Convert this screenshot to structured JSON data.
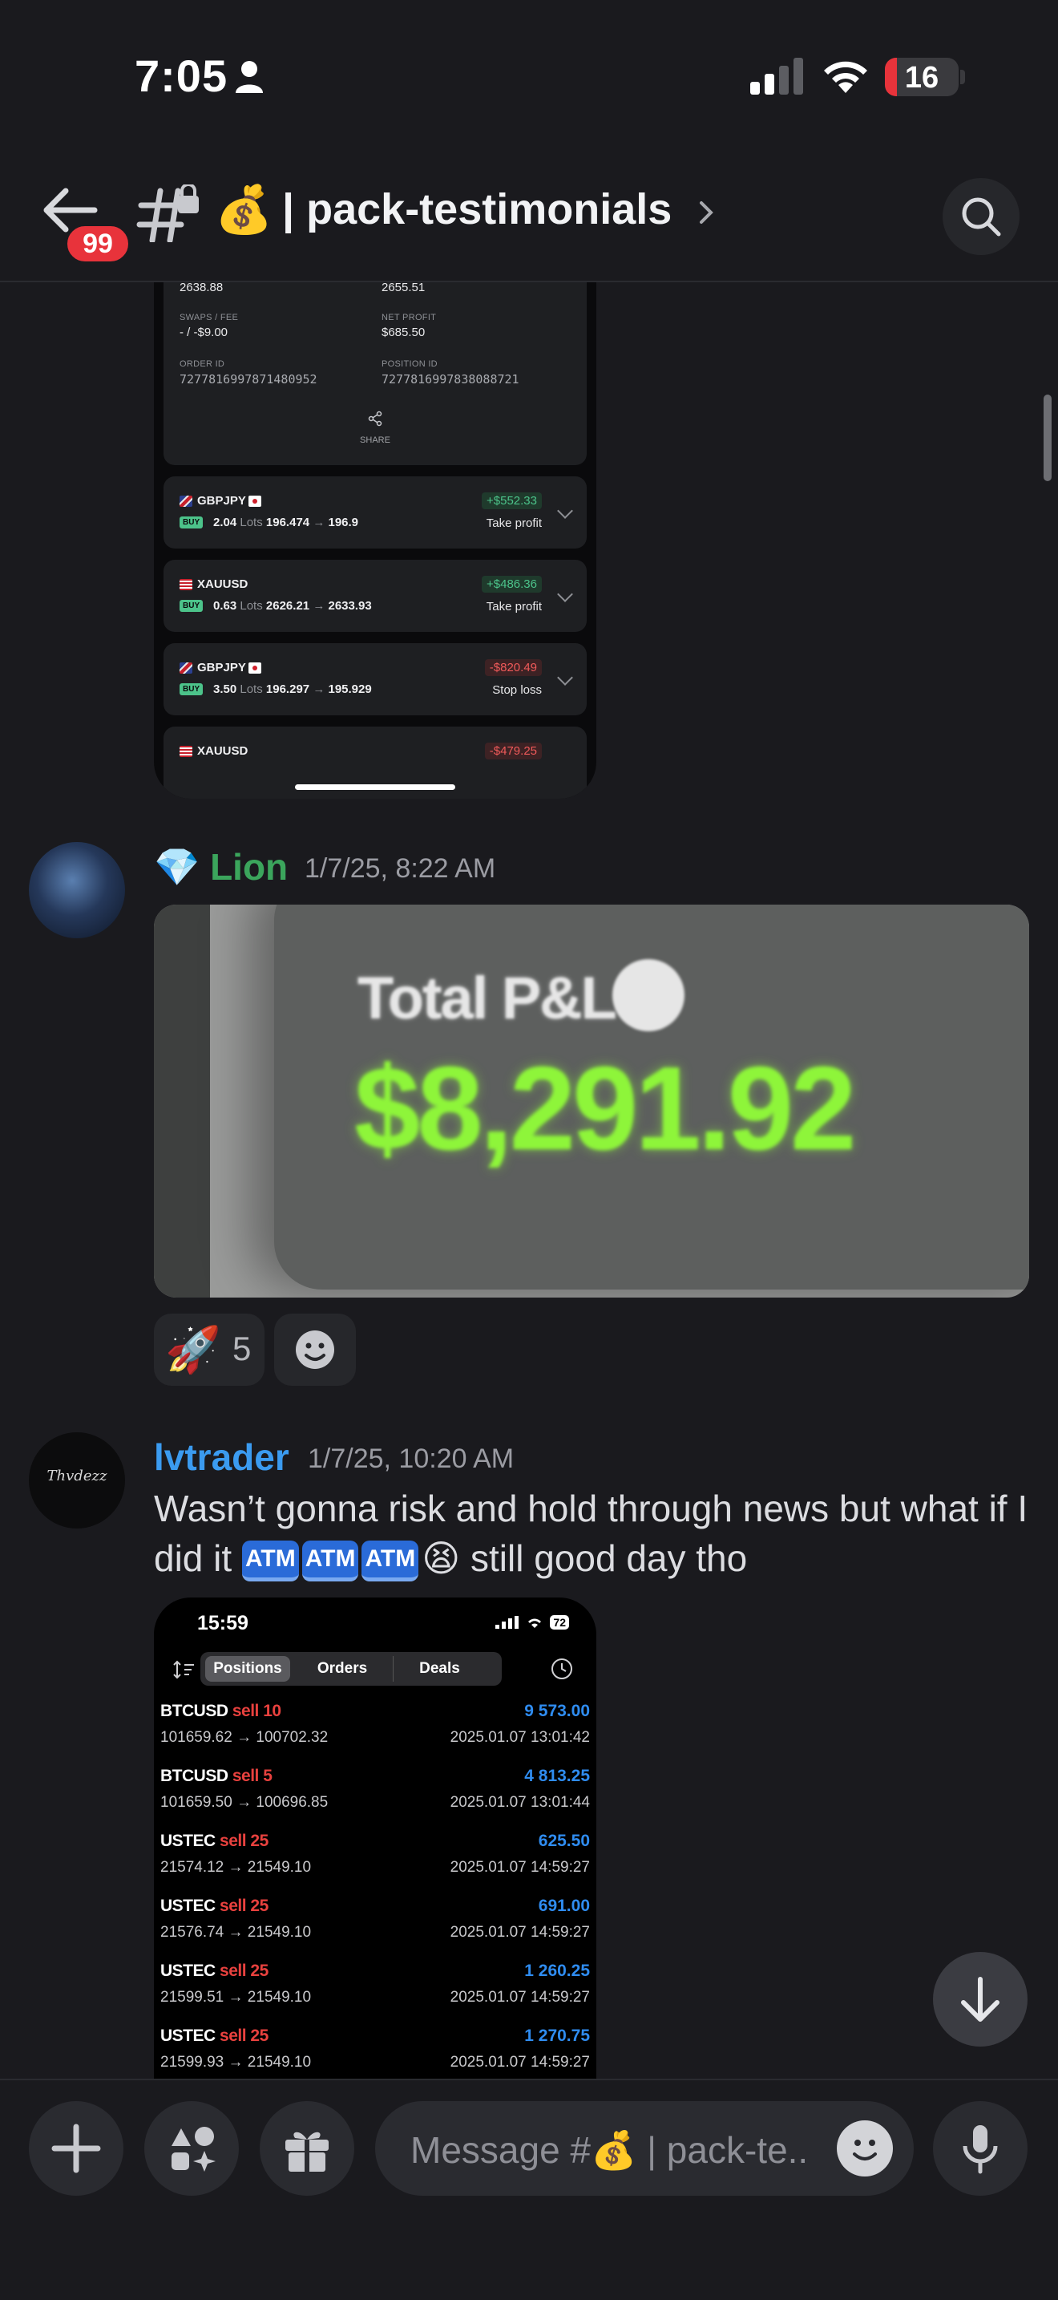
{
  "status_bar": {
    "time": "7:05",
    "battery": "16",
    "battery_level": 0.16
  },
  "header": {
    "badge": "99",
    "channel_emoji": "💰",
    "channel_name": "| pack-testimonials"
  },
  "shot1": {
    "entry_prices": [
      "2638.88",
      "2655.51"
    ],
    "swaps_label": "SWAPS / FEE",
    "swaps_value": "- / -$9.00",
    "net_profit_label": "NET PROFIT",
    "net_profit_value": "$685.50",
    "order_id_label": "ORDER ID",
    "order_id": "7277816997871480952",
    "position_id_label": "POSITION ID",
    "position_id": "7277816997838088721",
    "share_label": "SHARE",
    "trades": [
      {
        "symbol": "GBPJPY",
        "side": "BUY",
        "lots": "2.04",
        "lots_label": "Lots",
        "open": "196.474",
        "close": "196.9",
        "pnl": "+$552.33",
        "result": "Take profit",
        "positive": true
      },
      {
        "symbol": "XAUUSD",
        "side": "BUY",
        "lots": "0.63",
        "lots_label": "Lots",
        "open": "2626.21",
        "close": "2633.93",
        "pnl": "+$486.36",
        "result": "Take profit",
        "positive": true
      },
      {
        "symbol": "GBPJPY",
        "side": "BUY",
        "lots": "3.50",
        "lots_label": "Lots",
        "open": "196.297",
        "close": "195.929",
        "pnl": "-$820.49",
        "result": "Stop loss",
        "positive": false
      },
      {
        "symbol": "XAUUSD",
        "pnl": "-$479.25",
        "positive": false
      }
    ]
  },
  "messages": [
    {
      "emoji": "💎",
      "author": "Lion",
      "author_color": "#3ba55c",
      "timestamp": "1/7/25, 8:22 AM",
      "image": {
        "title": "Total P&L",
        "value": "$8,291.92"
      },
      "reactions": [
        {
          "emoji": "🚀",
          "count": "5"
        }
      ]
    },
    {
      "author": "lvtrader",
      "author_color": "#3b9bf0",
      "avatar_text": "Thvdezz",
      "timestamp": "1/7/25, 10:20 AM",
      "text_before": "Wasn’t gonna risk and hold through news but what if I did it ",
      "atm": [
        "ATM",
        "ATM",
        "ATM"
      ],
      "text_emoji": "😫",
      "text_after": " still good day tho"
    }
  ],
  "shot2": {
    "time": "15:59",
    "battery": "72",
    "tabs": [
      "Positions",
      "Orders",
      "Deals"
    ],
    "rows": [
      {
        "symbol": "BTCUSD",
        "side": "sell 10",
        "profit": "9 573.00",
        "prices": "101659.62 → 100702.32",
        "date": "2025.01.07 13:01:42"
      },
      {
        "symbol": "BTCUSD",
        "side": "sell 5",
        "profit": "4 813.25",
        "prices": "101659.50 → 100696.85",
        "date": "2025.01.07 13:01:44"
      },
      {
        "symbol": "USTEC",
        "side": "sell 25",
        "profit": "625.50",
        "prices": "21574.12 → 21549.10",
        "date": "2025.01.07 14:59:27"
      },
      {
        "symbol": "USTEC",
        "side": "sell 25",
        "profit": "691.00",
        "prices": "21576.74 → 21549.10",
        "date": "2025.01.07 14:59:27"
      },
      {
        "symbol": "USTEC",
        "side": "sell 25",
        "profit": "1 260.25",
        "prices": "21599.51 → 21549.10",
        "date": "2025.01.07 14:59:27"
      },
      {
        "symbol": "USTEC",
        "side": "sell 25",
        "profit": "1 270.75",
        "prices": "21599.93 → 21549.10",
        "date": "2025.01.07 14:59:27"
      }
    ]
  },
  "composer": {
    "placeholder": "Message #💰 | pack-te.."
  }
}
